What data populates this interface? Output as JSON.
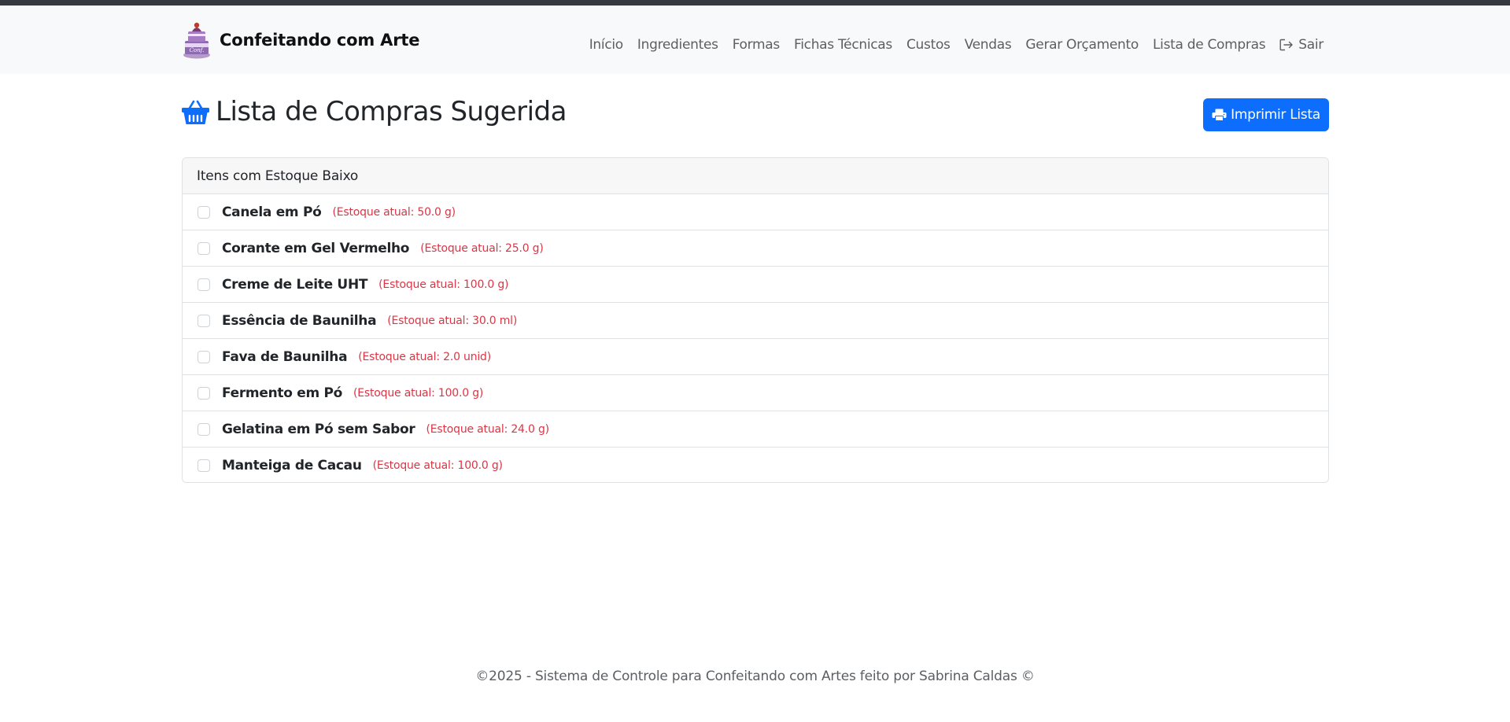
{
  "brand": {
    "name": "Confeitando com Arte"
  },
  "nav": {
    "items": [
      "Início",
      "Ingredientes",
      "Formas",
      "Fichas Técnicas",
      "Custos",
      "Vendas",
      "Gerar Orçamento",
      "Lista de Compras"
    ],
    "logout_label": "Sair"
  },
  "page": {
    "title": "Lista de Compras Sugerida",
    "print_label": "Imprimir Lista"
  },
  "card": {
    "header": "Itens com Estoque Baixo",
    "items": [
      {
        "name": "Canela em Pó",
        "stock": "(Estoque atual: 50.0 g)"
      },
      {
        "name": "Corante em Gel Vermelho",
        "stock": "(Estoque atual: 25.0 g)"
      },
      {
        "name": "Creme de Leite UHT",
        "stock": "(Estoque atual: 100.0 g)"
      },
      {
        "name": "Essência de Baunilha",
        "stock": "(Estoque atual: 30.0 ml)"
      },
      {
        "name": "Fava de Baunilha",
        "stock": "(Estoque atual: 2.0 unid)"
      },
      {
        "name": "Fermento em Pó",
        "stock": "(Estoque atual: 100.0 g)"
      },
      {
        "name": "Gelatina em Pó sem Sabor",
        "stock": "(Estoque atual: 24.0 g)"
      },
      {
        "name": "Manteiga de Cacau",
        "stock": "(Estoque atual: 100.0 g)"
      }
    ]
  },
  "footer": {
    "text": "©2025 - Sistema de Controle para Confeitando com Artes feito por Sabrina Caldas ©"
  },
  "colors": {
    "primary": "#0d6efd",
    "danger": "#dc3545",
    "navbar_bg": "#f8f9fa",
    "top_strip": "#343a40"
  },
  "icons": {
    "brand": "cake-logo-icon",
    "title": "basket-icon",
    "print": "printer-icon",
    "logout": "logout-icon"
  }
}
